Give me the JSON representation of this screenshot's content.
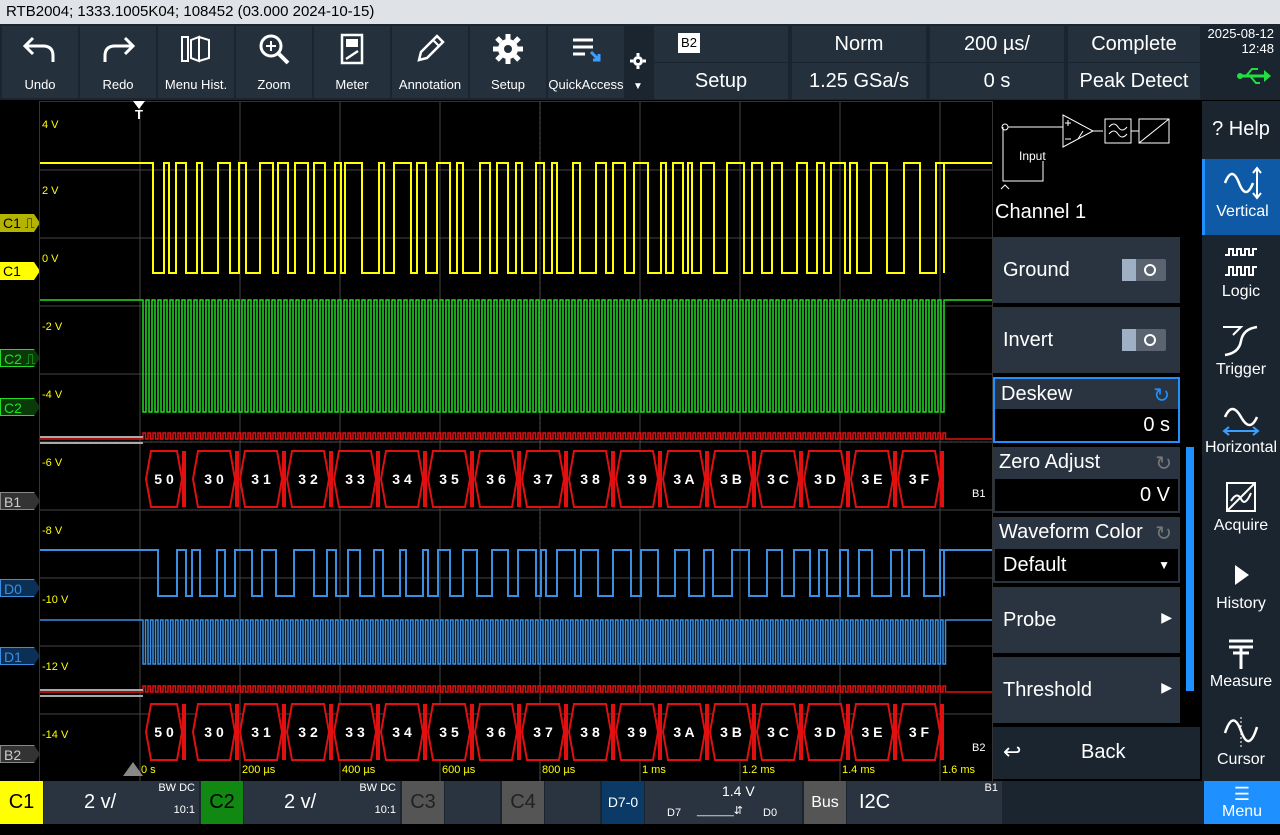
{
  "title_bar": "RTB2004; 1333.1005K04; 108452 (03.000 2024-10-15)",
  "toolbar": {
    "undo": "Undo",
    "redo": "Redo",
    "menu_hist": "Menu Hist.",
    "zoom": "Zoom",
    "meter": "Meter",
    "annotation": "Annotation",
    "setup": "Setup",
    "quickaccess": "QuickAccess"
  },
  "acq": {
    "bus_badge": "B2",
    "setup": "Setup",
    "trigger_mode": "Norm",
    "sample_rate": "1.25 GSa/s",
    "timebase": "200 µs/",
    "offset": "0 s",
    "status": "Complete",
    "acq_mode": "Peak Detect",
    "date": "2025-08-12",
    "time": "12:48"
  },
  "vscale": [
    "4 V",
    "2 V",
    "0 V",
    "-2 V",
    "-4 V",
    "-6 V",
    "-8 V",
    "-10 V",
    "-12 V",
    "-14 V"
  ],
  "tscale": [
    "0 s",
    "200 µs",
    "400 µs",
    "600 µs",
    "800 µs",
    "1 ms",
    "1.2 ms",
    "1.4 ms",
    "1.6 ms"
  ],
  "trigger_marker": "T",
  "channel_tags": {
    "c1a": "C1 ⎍",
    "c1": "C1",
    "c2a": "C2 ⎍",
    "c2": "C2",
    "b1": "B1",
    "d0": "D0",
    "d1": "D1",
    "b2": "B2"
  },
  "decode": {
    "first": "5 0",
    "bytes": [
      "3 0",
      "3 1",
      "3 2",
      "3 3",
      "3 4",
      "3 5",
      "3 6",
      "3 7",
      "3 8",
      "3 9",
      "3 A",
      "3 B",
      "3 C",
      "3 D",
      "3 E",
      "3 F"
    ],
    "b1_end_label": "B1",
    "b2_end_label": "B2"
  },
  "panel": {
    "input_label": "Input",
    "title": "Channel 1",
    "ground": "Ground",
    "invert": "Invert",
    "deskew": "Deskew",
    "deskew_value": "0 s",
    "zero_adjust": "Zero Adjust",
    "zero_value": "0 V",
    "waveform_color": "Waveform Color",
    "waveform_value": "Default",
    "probe": "Probe",
    "threshold": "Threshold",
    "back": "Back"
  },
  "menu": {
    "help": "Help",
    "vertical": "Vertical",
    "logic": "Logic",
    "trigger": "Trigger",
    "horizontal": "Horizontal",
    "acquire": "Acquire",
    "history": "History",
    "measure": "Measure",
    "cursor": "Cursor",
    "menu": "Menu"
  },
  "bottom": {
    "c1": "C1",
    "c1_scale": "2 v/",
    "c1_bw": "BW DC",
    "c1_probe": "10:1",
    "c2": "C2",
    "c2_scale": "2 v/",
    "c2_bw": "BW DC",
    "c2_probe": "10:1",
    "c3": "C3",
    "c4": "C4",
    "d70": "D7-0",
    "d_thresh": "1.4 V",
    "d7": "D7",
    "d0": "D0",
    "bus": "Bus",
    "bus_type": "I2C",
    "bus_id": "B1"
  },
  "colors": {
    "c1": "#ffff00",
    "c2": "#22dd22",
    "bus": "#e01010",
    "digital": "#3b8fe0",
    "accent": "#1e90ff"
  }
}
